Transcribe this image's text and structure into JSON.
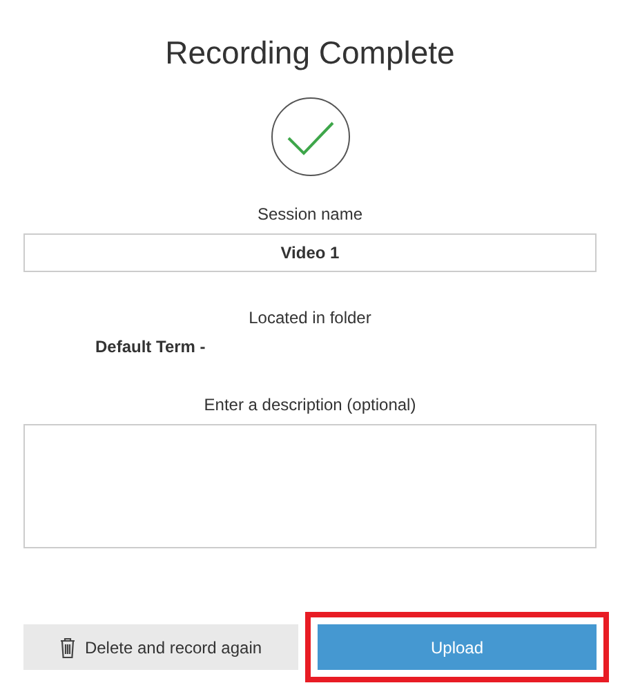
{
  "title": "Recording Complete",
  "session": {
    "label": "Session name",
    "value": "Video 1"
  },
  "folder": {
    "label": "Located in folder",
    "value": "Default Term -"
  },
  "description": {
    "label": "Enter a description (optional)"
  },
  "buttons": [
    {
      "kind": "delete",
      "label": "Delete and record again",
      "highlighted": false
    },
    {
      "kind": "primary",
      "label": "Upload",
      "highlighted": true
    }
  ]
}
